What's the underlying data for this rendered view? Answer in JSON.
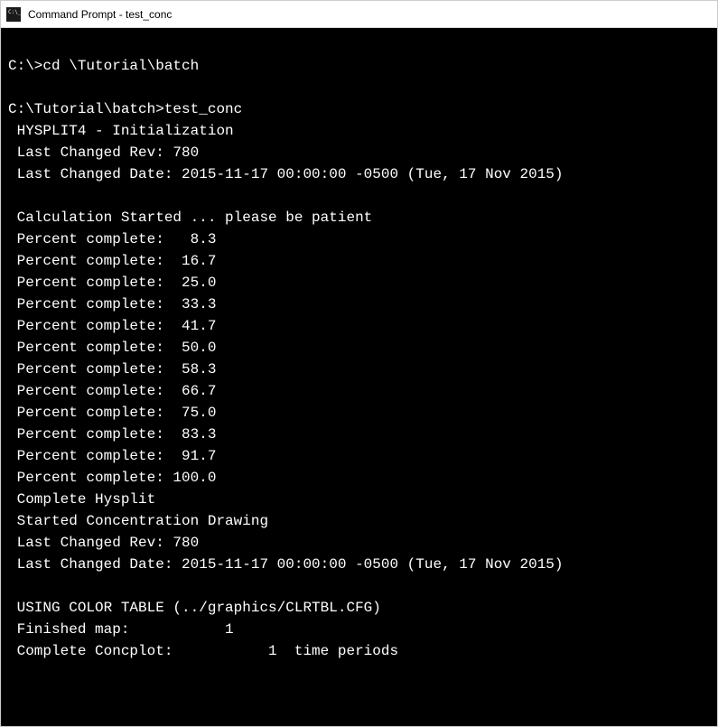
{
  "window": {
    "title": "Command Prompt - test_conc"
  },
  "terminal": {
    "lines": [
      "",
      "C:\\>cd \\Tutorial\\batch",
      "",
      "C:\\Tutorial\\batch>test_conc",
      " HYSPLIT4 - Initialization",
      " Last Changed Rev: 780",
      " Last Changed Date: 2015-11-17 00:00:00 -0500 (Tue, 17 Nov 2015)",
      "",
      " Calculation Started ... please be patient",
      " Percent complete:   8.3",
      " Percent complete:  16.7",
      " Percent complete:  25.0",
      " Percent complete:  33.3",
      " Percent complete:  41.7",
      " Percent complete:  50.0",
      " Percent complete:  58.3",
      " Percent complete:  66.7",
      " Percent complete:  75.0",
      " Percent complete:  83.3",
      " Percent complete:  91.7",
      " Percent complete: 100.0",
      " Complete Hysplit",
      " Started Concentration Drawing",
      " Last Changed Rev: 780",
      " Last Changed Date: 2015-11-17 00:00:00 -0500 (Tue, 17 Nov 2015)",
      "",
      " USING COLOR TABLE (../graphics/CLRTBL.CFG)",
      " Finished map:           1",
      " Complete Concplot:           1  time periods"
    ]
  }
}
